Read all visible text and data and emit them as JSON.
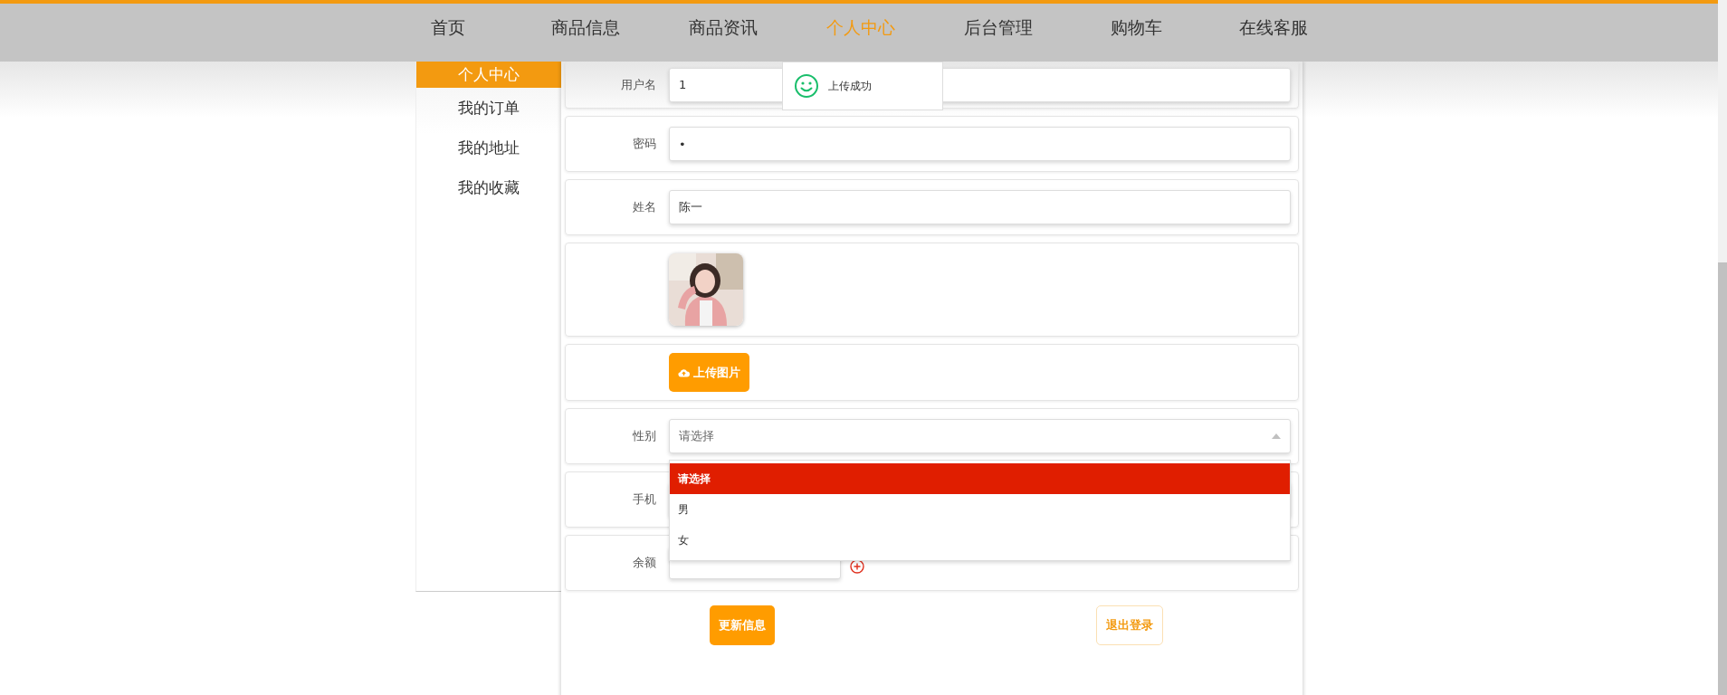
{
  "nav": {
    "items": [
      {
        "label": "首页",
        "selected": false
      },
      {
        "label": "商品信息",
        "selected": false
      },
      {
        "label": "商品资讯",
        "selected": false
      },
      {
        "label": "个人中心",
        "selected": true
      },
      {
        "label": "后台管理",
        "selected": false
      },
      {
        "label": "购物车",
        "selected": false
      },
      {
        "label": "在线客服",
        "selected": false
      }
    ]
  },
  "sidebar": {
    "items": [
      {
        "label": "个人中心",
        "selected": true
      },
      {
        "label": "我的订单",
        "selected": false
      },
      {
        "label": "我的地址",
        "selected": false
      },
      {
        "label": "我的收藏",
        "selected": false
      }
    ]
  },
  "toast": {
    "message": "上传成功"
  },
  "form": {
    "fields": [
      {
        "kind": "text",
        "label": "用户名",
        "value": "1"
      },
      {
        "kind": "text",
        "label": "密码",
        "value": "•"
      },
      {
        "kind": "text",
        "label": "姓名",
        "value": "陈一"
      },
      {
        "kind": "avatar"
      },
      {
        "kind": "upload",
        "button": "上传图片"
      },
      {
        "kind": "select",
        "label": "性别",
        "placeholder": "请选择",
        "expanded": true,
        "options": [
          {
            "label": "请选择",
            "selected": true
          },
          {
            "label": "男",
            "selected": false
          },
          {
            "label": "女",
            "selected": false
          }
        ]
      },
      {
        "kind": "text",
        "label": "手机"
      },
      {
        "kind": "balance",
        "label": "余额"
      }
    ]
  },
  "buttons": [
    {
      "kind": "primary",
      "label": "更新信息"
    },
    {
      "kind": "outline",
      "label": "退出登录"
    }
  ]
}
